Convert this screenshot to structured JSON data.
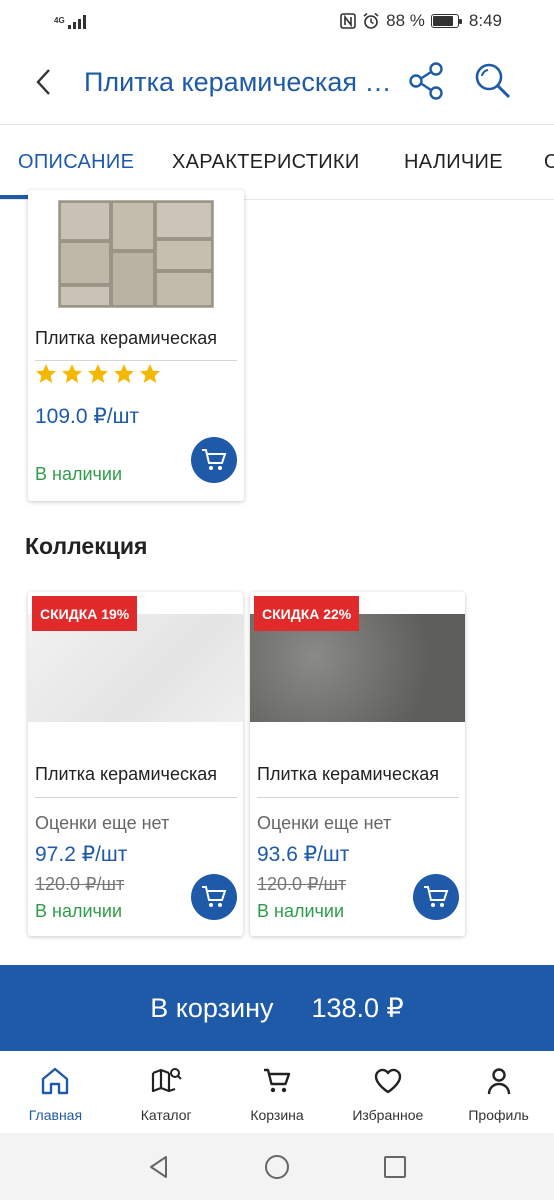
{
  "status_bar": {
    "network_label": "4G",
    "battery": "88 %",
    "battery_level": 0.88,
    "time": "8:49"
  },
  "app_bar": {
    "title": "Плитка керамическая фасадная"
  },
  "tabs": [
    {
      "label": "ОПИСАНИЕ",
      "active": true
    },
    {
      "label": "ХАРАКТЕРИСТИКИ",
      "active": false
    },
    {
      "label": "НАЛИЧИЕ",
      "active": false
    },
    {
      "label": "О",
      "active": false
    }
  ],
  "top_card": {
    "name": "Плитка керамическая",
    "rating_stars": 5,
    "price": "109.0 ₽/шт",
    "stock": "В наличии"
  },
  "collection": {
    "title": "Коллекция",
    "items": [
      {
        "badge": "СКИДКА 19%",
        "name": "Плитка керамическая",
        "rating_text": "Оценки еще нет",
        "price": "97.2 ₽/шт",
        "old_price": "120.0 ₽/шт",
        "stock": "В наличии",
        "image_tone": "#ececec"
      },
      {
        "badge": "СКИДКА 22%",
        "name": "Плитка керамическая",
        "rating_text": "Оценки еще нет",
        "price": "93.6 ₽/шт",
        "old_price": "120.0 ₽/шт",
        "stock": "В наличии",
        "image_tone": "#6e6e6b"
      }
    ]
  },
  "add_to_cart": {
    "label": "В корзину",
    "total": "138.0 ₽"
  },
  "bottom_nav": [
    {
      "label": "Главная",
      "icon": "home-icon",
      "active": true
    },
    {
      "label": "Каталог",
      "icon": "catalog-icon",
      "active": false
    },
    {
      "label": "Корзина",
      "icon": "cart-icon",
      "active": false
    },
    {
      "label": "Избранное",
      "icon": "heart-icon",
      "active": false
    },
    {
      "label": "Профиль",
      "icon": "profile-icon",
      "active": false
    }
  ],
  "colors": {
    "accent": "#1e5aa8",
    "in_stock": "#2e9d4a",
    "discount_badge": "#e12b2b",
    "star": "#f5b800"
  }
}
